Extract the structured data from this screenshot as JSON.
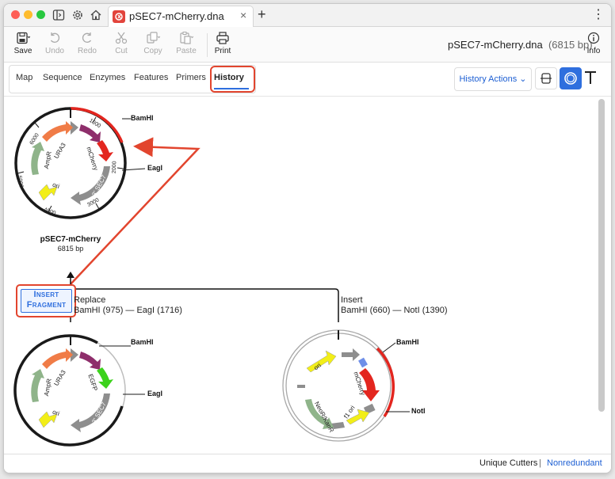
{
  "titlebar": {
    "tab_title": "pSEC7-mCherry.dna",
    "tab_close": "×",
    "new_tab": "+",
    "menu": "⋮"
  },
  "toolbar": {
    "save": "Save",
    "undo": "Undo",
    "redo": "Redo",
    "cut": "Cut",
    "copy": "Copy",
    "paste": "Paste",
    "print": "Print",
    "info": "Info",
    "doc_name": "pSEC7-mCherry.dna",
    "doc_size": "(6815 bp)"
  },
  "view_tabs": [
    "Map",
    "Sequence",
    "Enzymes",
    "Features",
    "Primers",
    "History"
  ],
  "active_view": "History",
  "history_actions": "History Actions",
  "top_map": {
    "name": "pSEC7-mCherry",
    "length": "6815 bp",
    "features": [
      "URA3",
      "mCherry",
      "AmpR",
      "ori",
      "3' SEC7"
    ],
    "sites": [
      "BamHI",
      "EagI"
    ],
    "ticks": [
      "1000",
      "2000",
      "3000",
      "4000",
      "5000",
      "6000"
    ]
  },
  "operation": {
    "badge_line1": "Insert",
    "badge_line2": "Fragment",
    "left_title": "Replace",
    "left_detail": "BamHI (975)  —  EagI (1716)",
    "right_title": "Insert",
    "right_detail": "BamHI (660)  —  NotI (1390)"
  },
  "left_map": {
    "features": [
      "URA3",
      "EGFP",
      "AmpR",
      "ori",
      "3' SEC7"
    ],
    "sites": [
      "BamHI",
      "EagI"
    ]
  },
  "right_map": {
    "features": [
      "ori",
      "mCherry",
      "NeoR/KanR",
      "f1 ori"
    ],
    "sites": [
      "BamHI",
      "NotI"
    ]
  },
  "status": {
    "left": "Unique Cutters",
    "sep": "|",
    "right": "Nonredundant"
  },
  "colors": {
    "highlight": "#e2452e",
    "accent": "#2f6fde",
    "mcherry": "#e3261f",
    "egfp": "#3cd21c",
    "ura3": "#f07c47",
    "ampr": "#8fb48a",
    "ori": "#f2ee18",
    "sec7": "#8e8e8e",
    "purple": "#8e2e6b"
  }
}
